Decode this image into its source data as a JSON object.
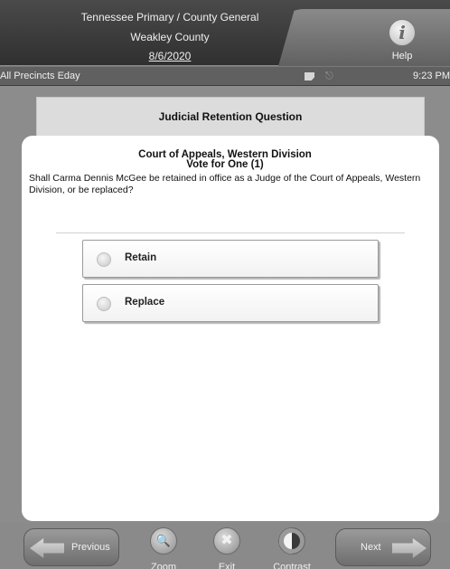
{
  "header": {
    "election_title": "Tennessee Primary / County General",
    "county": "Weakley County",
    "date": "8/6/2020",
    "help_label": "Help",
    "help_icon": "info-icon"
  },
  "status_bar": {
    "precinct": "All Precincts Eday",
    "time": "9:23 PM",
    "icons": [
      "memo-icon",
      "plug-icon"
    ]
  },
  "contest": {
    "header_title": "Judicial Retention Question",
    "race_name": "Court of Appeals, Western Division",
    "vote_for": "Vote for One (1)",
    "question": "Shall Carma Dennis McGee be retained in office as a Judge of the Court of Appeals, Western Division, or be replaced?",
    "options": [
      {
        "label": "Retain",
        "selected": false
      },
      {
        "label": "Replace",
        "selected": false
      }
    ]
  },
  "footer": {
    "previous_label": "Previous",
    "next_label": "Next",
    "zoom_label": "Zoom",
    "exit_label": "Exit",
    "contrast_label": "Contrast"
  }
}
